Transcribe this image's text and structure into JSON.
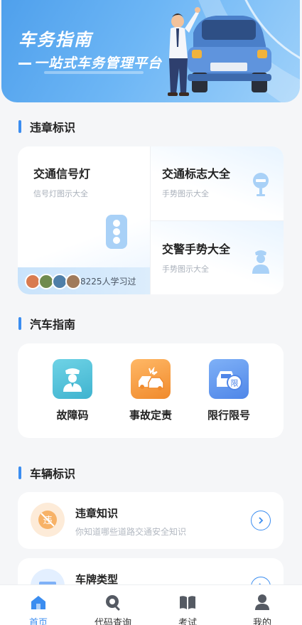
{
  "banner": {
    "title": "车务指南",
    "subtitle": "一站式车务管理平台"
  },
  "sections": {
    "violation_signs": "违章标识",
    "car_guide": "汽车指南",
    "vehicle_signs": "车辆标识"
  },
  "sign_cards": {
    "traffic_light": {
      "title": "交通信号灯",
      "subtitle": "信号灯图示大全"
    },
    "traffic_signs": {
      "title": "交通标志大全",
      "subtitle": "手势图示大全"
    },
    "police_gestures": {
      "title": "交警手势大全",
      "subtitle": "手势图示大全"
    },
    "learners": "8225人学习过"
  },
  "car_guide": [
    {
      "label": "故障码",
      "icon": "police-icon",
      "color": "#4bbfd6"
    },
    {
      "label": "事故定责",
      "icon": "crash-icon",
      "color": "#f39a3c"
    },
    {
      "label": "限行限号",
      "icon": "restricted-car-icon",
      "color": "#5b95f0"
    }
  ],
  "vehicle_list": [
    {
      "title": "违章知识",
      "subtitle": "你知道哪些道路交通安全知识",
      "icon": "no-violation-icon"
    },
    {
      "title": "车牌类型",
      "subtitle": "",
      "icon": "license-plate-icon"
    }
  ],
  "tabbar": [
    {
      "label": "首页",
      "icon": "home-icon",
      "active": true
    },
    {
      "label": "代码查询",
      "icon": "search-icon",
      "active": false
    },
    {
      "label": "考试",
      "icon": "book-icon",
      "active": false
    },
    {
      "label": "我的",
      "icon": "user-icon",
      "active": false
    }
  ],
  "colors": {
    "accent": "#3b8df0",
    "banner": "#5aa8f0"
  }
}
